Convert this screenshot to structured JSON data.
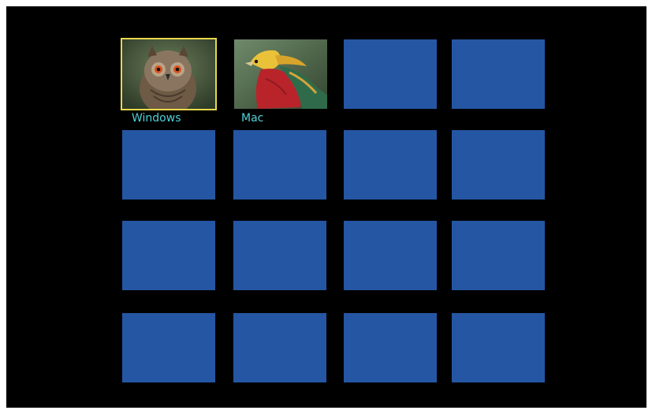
{
  "colors": {
    "background": "#000000",
    "empty_tile": "#2556a3",
    "selection_border": "#e8d84a",
    "label_text": "#4fd1d9"
  },
  "profiles": [
    {
      "label": "Windows",
      "avatar": "owl-avatar",
      "selected": true
    },
    {
      "label": "Mac",
      "avatar": "pheasant-avatar",
      "selected": false
    }
  ],
  "empty_slots": 14
}
